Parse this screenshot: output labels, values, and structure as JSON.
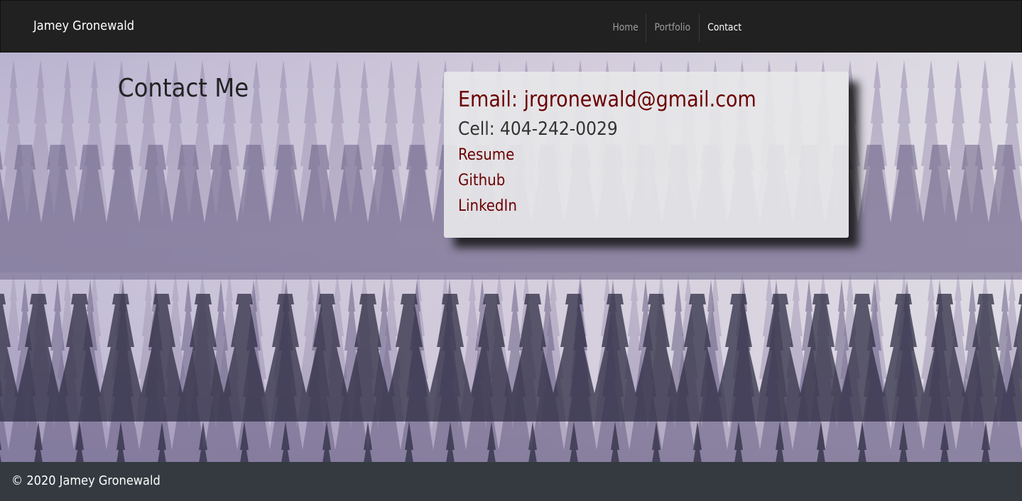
{
  "navbar": {
    "brand": "Jamey Gronewald",
    "links": [
      {
        "label": "Home"
      },
      {
        "label": "Portfolio"
      },
      {
        "label": "Contact"
      }
    ]
  },
  "contact": {
    "title": "Contact Me",
    "email": "Email: jrgronewald@gmail.com",
    "cell": "Cell: 404-242-0029",
    "links": [
      {
        "label": "Resume"
      },
      {
        "label": "Github"
      },
      {
        "label": "LinkedIn"
      }
    ]
  },
  "footer": {
    "text": "© 2020 Jamey Gronewald"
  },
  "colors": {
    "navbar": "#212121",
    "footer": "#343a40",
    "link": "#6b0000"
  }
}
